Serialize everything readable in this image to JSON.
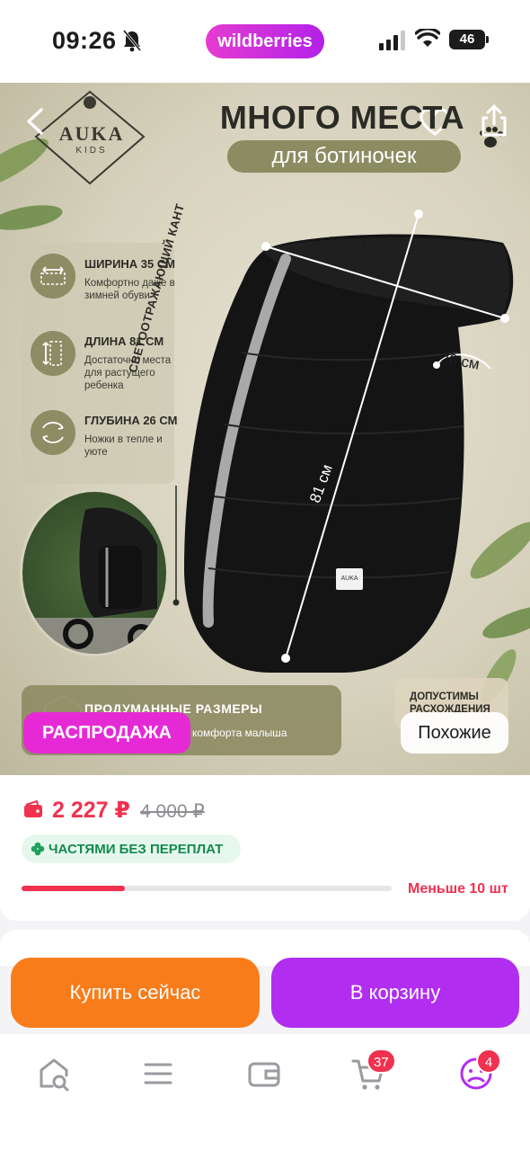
{
  "status_bar": {
    "time": "09:26",
    "app_pill": "wildberries",
    "battery": "46"
  },
  "hero": {
    "brand": {
      "name": "AUKA",
      "sub": "KIDS"
    },
    "title": "МНОГО МЕСТА",
    "subtitle": "для ботиночек",
    "features": [
      {
        "title": "ШИРИНА 35 СМ",
        "desc": "Комфортно даже в зимней обуви",
        "icon": "width-arrows-icon"
      },
      {
        "title": "ДЛИНА 81 СМ",
        "desc": "Достаточно места для растущего ребенка",
        "icon": "height-arrows-icon"
      },
      {
        "title": "ГЛУБИНА 26 СМ",
        "desc": "Ножки в тепле и уюте",
        "icon": "depth-arrows-icon"
      }
    ],
    "reflective_label": "СВЕТООТРАЖАЮЩИЙ КАНТ",
    "dimensions": {
      "width": "35 см",
      "depth": "26 см",
      "length": "81 см"
    },
    "bag_tag": "AUKA",
    "bottom_panel": {
      "title": "ПРОДУМАННЫЕ РАЗМЕРЫ",
      "desc": "комфорта малыша"
    },
    "note": "ДОПУСТИМЫ РАСХОЖДЕНИЯ",
    "sale_badge": "РАСПРОДАЖА",
    "similar_button": "Похожие"
  },
  "price": {
    "current": "2 227 ₽",
    "old": "4 000 ₽",
    "installment": "ЧАСТЯМИ БЕЗ ПЕРЕПЛАТ",
    "stock_fraction": 0.28,
    "stock_text": "Меньше 10 шт"
  },
  "actions": {
    "buy_now": "Купить сейчас",
    "add_to_cart": "В корзину"
  },
  "tab_bar": {
    "items": [
      {
        "icon": "home-search-icon"
      },
      {
        "icon": "menu-icon"
      },
      {
        "icon": "wallet-icon"
      },
      {
        "icon": "cart-icon",
        "badge": "37"
      },
      {
        "icon": "profile-icon",
        "badge": "4"
      }
    ]
  },
  "colors": {
    "accent_red": "#f0314f",
    "sale_pink": "#e52ad5",
    "buy_orange": "#f97c1a",
    "cart_purple": "#b12ef0",
    "green": "#138a4f"
  }
}
